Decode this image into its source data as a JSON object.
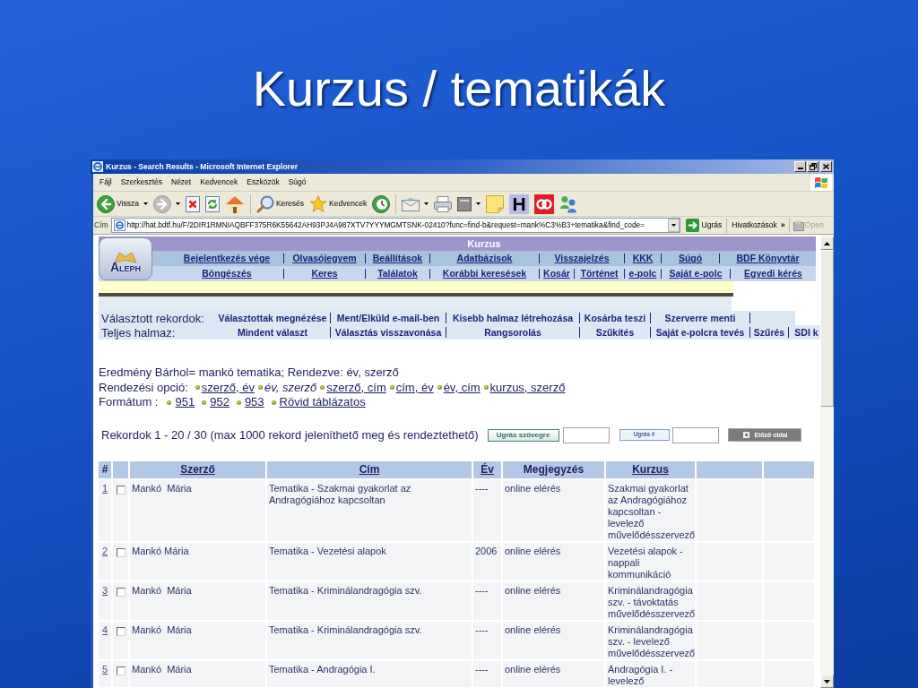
{
  "slide": {
    "title": "Kurzus / tematikák"
  },
  "window": {
    "title": "Kurzus - Search Results - Microsoft Internet Explorer"
  },
  "menu": [
    "Fájl",
    "Szerkesztés",
    "Nézet",
    "Kedvencek",
    "Eszközök",
    "Súgó"
  ],
  "toolbar": [
    {
      "kind": "back",
      "label": "Vissza",
      "dropdown": true,
      "disabled": false
    },
    {
      "kind": "forward",
      "dropdown": true,
      "disabled": true
    },
    {
      "kind": "stop",
      "dropdown": false,
      "disabled": false
    },
    {
      "kind": "refresh",
      "dropdown": false,
      "disabled": false
    },
    {
      "kind": "home",
      "dropdown": false,
      "disabled": false
    },
    {
      "kind": "separator"
    },
    {
      "kind": "search",
      "label": "Keresés",
      "dropdown": false,
      "disabled": false
    },
    {
      "kind": "favorites",
      "label": "Kedvencek",
      "dropdown": false,
      "disabled": false
    },
    {
      "kind": "history",
      "dropdown": false,
      "disabled": false
    },
    {
      "kind": "separator"
    },
    {
      "kind": "mail",
      "dropdown": true,
      "disabled": false
    },
    {
      "kind": "print",
      "dropdown": false,
      "disabled": false
    },
    {
      "kind": "edit",
      "dropdown": true,
      "disabled": false
    },
    {
      "kind": "note",
      "dropdown": false,
      "disabled": false
    },
    {
      "kind": "letter",
      "label": "H",
      "dropdown": false,
      "disabled": false
    },
    {
      "kind": "rings",
      "dropdown": false,
      "disabled": false
    },
    {
      "kind": "people",
      "dropdown": false,
      "disabled": false
    }
  ],
  "address_bar": {
    "label": "Cím",
    "url": "http://hat.bdtf.hu/F/2DIR1RMNIAQBFF375R6K55642AH93PJ4A987XTV7YYYMGMTSNK-02410?func=find-b&request=mank%C3%B3+tematika&find_code=",
    "go_button": "Ugrás",
    "links_button": "Hivatkozások",
    "more_button": "»",
    "open_button": {
      "label": "Open",
      "disabled": true
    }
  },
  "page": {
    "logo": "ALEPH",
    "header_title": "Kurzus",
    "nav_rows": [
      [
        "Bejelentkezés vége",
        "Olvasójegyem",
        "Beállítások",
        "Adatbázisok",
        "Visszajelzés",
        "KKK",
        "Súgó",
        "BDF Könyvtár"
      ],
      [
        "Böngészés",
        "Keres",
        "Találatok",
        "Korábbi keresések",
        "Kosár",
        "Történet",
        "e-polc",
        "Saját e-polc",
        "Egyedi kérés"
      ]
    ],
    "selected_records": {
      "label": "Választott rekordok:",
      "actions": [
        "Választottak megnézése",
        "Ment/Elküld e-mail-ben",
        "Kisebb halmaz létrehozása",
        "Kosárba teszi",
        "Szerverre menti"
      ]
    },
    "all_records": {
      "label": "Teljes halmaz:",
      "actions": [
        "Mindent választ",
        "Választás visszavonása",
        "Rangsorolás",
        "Szűkítés",
        "Saját e-polcra tevés",
        "Szűrés",
        "SDI k"
      ]
    },
    "result_summary": "Eredmény Bárhol= mankó tematika; Rendezve: év, szerző",
    "sort": {
      "label": "Rendezési opció:",
      "options": [
        {
          "label": "szerző, év",
          "selected": false
        },
        {
          "label": "év, szerző",
          "selected": true
        },
        {
          "label": "szerző, cím",
          "selected": false
        },
        {
          "label": "cím, év",
          "selected": false
        },
        {
          "label": "év, cím",
          "selected": false
        },
        {
          "label": "kurzus, szerző",
          "selected": false
        }
      ]
    },
    "format": {
      "label": "Formátum :",
      "options": [
        "951",
        "952",
        "953",
        "Rövid táblázatos"
      ]
    },
    "records_info": "Rekordok 1 - 20 / 30 (max 1000 rekord jeleníthető meg és rendeztethető)",
    "jump_text_button": "Ugrás szövegre",
    "jump_number_button": "Ugrás #",
    "previous_button": "Előző oldal",
    "table": {
      "columns": [
        {
          "label": "#",
          "sortable": false
        },
        {
          "label": "Szerző",
          "sortable": true
        },
        {
          "label": "Cím",
          "sortable": true
        },
        {
          "label": "Év",
          "sortable": true
        },
        {
          "label": "Megjegyzés",
          "sortable": false
        },
        {
          "label": "Kurzus",
          "sortable": true
        }
      ],
      "rows": [
        {
          "number": "1",
          "checked": false,
          "author": "Mankó  Mária",
          "title": "Tematika - Szakmai gyakorlat az Andragógiához kapcsoltan",
          "year": "----",
          "note": "online elérés",
          "course": "Szakmai gyakorlat az Andragógiához kapcsoltan - levelező művelődésszervező"
        },
        {
          "number": "2",
          "checked": false,
          "author": "Mankó Mária",
          "title": "Tematika - Vezetési alapok",
          "year": "2006",
          "note": "online elérés",
          "course": "Vezetési alapok - nappali kommunikáció"
        },
        {
          "number": "3",
          "checked": false,
          "author": "Mankó  Mária",
          "title": "Tematika - Kriminálandragógia szv.",
          "year": "----",
          "note": "online elérés",
          "course": "Kriminálandragógia szv. - távoktatás művelődésszervező"
        },
        {
          "number": "4",
          "checked": false,
          "author": "Mankó  Mária",
          "title": "Tematika - Kriminálandragógia szv.",
          "year": "----",
          "note": "online elérés",
          "course": "Kriminálandragógia szv. - levelező művelődésszervező"
        },
        {
          "number": "5",
          "checked": false,
          "author": "Mankó  Mária",
          "title": "Tematika - Andragógia I.",
          "year": "----",
          "note": "online elérés",
          "course": "Andragógia I. - levelező"
        }
      ]
    }
  }
}
